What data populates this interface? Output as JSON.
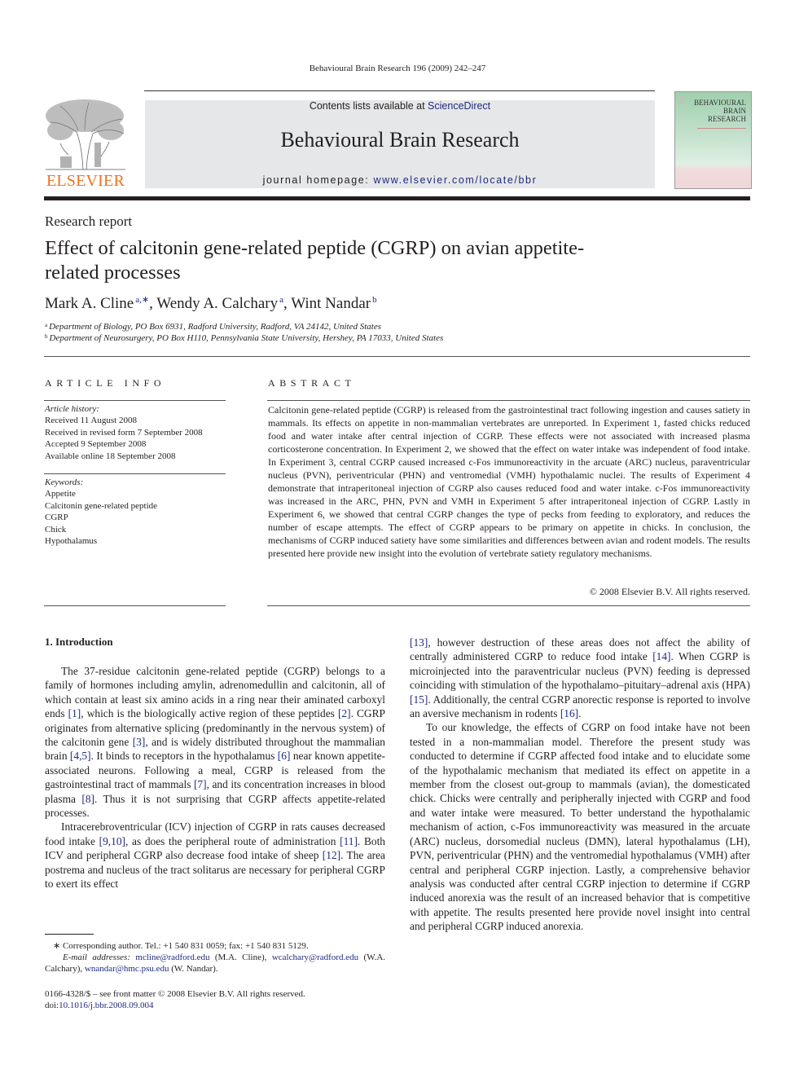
{
  "running_head": "Behavioural Brain Research 196 (2009) 242–247",
  "masthead": {
    "contents_prefix": "Contents lists available at ",
    "contents_link": "ScienceDirect",
    "journal_title": "Behavioural Brain Research",
    "homepage_prefix": "journal homepage: ",
    "homepage_link": "www.elsevier.com/locate/bbr",
    "publisher_logo_text": "ELSEVIER",
    "cover_title_lines": [
      "BEHAVIOURAL",
      "BRAIN",
      "RESEARCH"
    ],
    "colors": {
      "publisher_orange": "#f36f21",
      "link_blue": "#1f2a80",
      "masthead_gray": "#e6e7e8"
    }
  },
  "article": {
    "type": "Research report",
    "title": "Effect of calcitonin gene-related peptide (CGRP) on avian appetite-related processes",
    "authors": [
      {
        "name": "Mark A. Cline",
        "marks": "a,∗"
      },
      {
        "name": "Wendy A. Calchary",
        "marks": "a"
      },
      {
        "name": "Wint Nandar",
        "marks": "b"
      }
    ],
    "affiliations": [
      {
        "mark": "a",
        "text": "Department of Biology, PO Box 6931, Radford University, Radford, VA 24142, United States"
      },
      {
        "mark": "b",
        "text": "Department of Neurosurgery, PO Box H110, Pennsylvania State University, Hershey, PA 17033, United States"
      }
    ]
  },
  "article_info": {
    "heading": "ARTICLE INFO",
    "history_label": "Article history:",
    "history": [
      "Received 11 August 2008",
      "Received in revised form 7 September 2008",
      "Accepted 9 September 2008",
      "Available online 18 September 2008"
    ],
    "keywords_label": "Keywords:",
    "keywords": [
      "Appetite",
      "Calcitonin gene-related peptide",
      "CGRP",
      "Chick",
      "Hypothalamus"
    ]
  },
  "abstract": {
    "heading": "ABSTRACT",
    "text": "Calcitonin gene-related peptide (CGRP) is released from the gastrointestinal tract following ingestion and causes satiety in mammals. Its effects on appetite in non-mammalian vertebrates are unreported. In Experiment 1, fasted chicks reduced food and water intake after central injection of CGRP. These effects were not associated with increased plasma corticosterone concentration. In Experiment 2, we showed that the effect on water intake was independent of food intake. In Experiment 3, central CGRP caused increased c-Fos immunoreactivity in the arcuate (ARC) nucleus, paraventricular nucleus (PVN), periventricular (PHN) and ventromedial (VMH) hypothalamic nuclei. The results of Experiment 4 demonstrate that intraperitoneal injection of CGRP also causes reduced food and water intake. c-Fos immunoreactivity was increased in the ARC, PHN, PVN and VMH in Experiment 5 after intraperitoneal injection of CGRP. Lastly in Experiment 6, we showed that central CGRP changes the type of pecks from feeding to exploratory, and reduces the number of escape attempts. The effect of CGRP appears to be primary on appetite in chicks. In conclusion, the mechanisms of CGRP induced satiety have some similarities and differences between avian and rodent models. The results presented here provide new insight into the evolution of vertebrate satiety regulatory mechanisms.",
    "copyright": "© 2008 Elsevier B.V. All rights reserved."
  },
  "introduction": {
    "heading": "1.  Introduction",
    "paragraphs": [
      [
        {
          "t": "The 37-residue calcitonin gene-related peptide (CGRP) belongs to a family of hormones including amylin, adrenomedullin and calcitonin, all of which contain at least six amino acids in a ring near their aminated carboxyl ends "
        },
        {
          "ref": "[1]"
        },
        {
          "t": ", which is the biologically active region of these peptides "
        },
        {
          "ref": "[2]"
        },
        {
          "t": ". CGRP originates from alternative splicing (predominantly in the nervous system) of the calcitonin gene "
        },
        {
          "ref": "[3]"
        },
        {
          "t": ", and is widely distributed throughout the mammalian brain "
        },
        {
          "ref": "[4,5]"
        },
        {
          "t": ". It binds to receptors in the hypothalamus "
        },
        {
          "ref": "[6]"
        },
        {
          "t": " near known appetite-associated neurons. Following a meal, CGRP is released from the gastrointestinal tract of mammals "
        },
        {
          "ref": "[7]"
        },
        {
          "t": ", and its concentration increases in blood plasma "
        },
        {
          "ref": "[8]"
        },
        {
          "t": ". Thus it is not surprising that CGRP affects appetite-related processes."
        }
      ],
      [
        {
          "t": "Intracerebroventricular (ICV) injection of CGRP in rats causes decreased food intake "
        },
        {
          "ref": "[9,10]"
        },
        {
          "t": ", as does the peripheral route of administration "
        },
        {
          "ref": "[11]"
        },
        {
          "t": ". Both ICV and peripheral CGRP also decrease food intake of sheep "
        },
        {
          "ref": "[12]"
        },
        {
          "t": ". The area postrema and nucleus of the tract solitarus are necessary for peripheral CGRP to exert its effect"
        }
      ],
      [
        {
          "ref": "[13]"
        },
        {
          "t": ", however destruction of these areas does not affect the ability of centrally administered CGRP to reduce food intake "
        },
        {
          "ref": "[14]"
        },
        {
          "t": ". When CGRP is microinjected into the paraventricular nucleus (PVN) feeding is depressed coinciding with stimulation of the hypothalamo–pituitary–adrenal axis (HPA) "
        },
        {
          "ref": "[15]"
        },
        {
          "t": ". Additionally, the central CGRP anorectic response is reported to involve an aversive mechanism in rodents "
        },
        {
          "ref": "[16]"
        },
        {
          "t": "."
        }
      ],
      [
        {
          "t": "To our knowledge, the effects of CGRP on food intake have not been tested in a non-mammalian model. Therefore the present study was conducted to determine if CGRP affected food intake and to elucidate some of the hypothalamic mechanism that mediated its effect on appetite in a member from the closest out-group to mammals (avian), the domesticated chick. Chicks were centrally and peripherally injected with CGRP and food and water intake were measured. To better understand the hypothalamic mechanism of action, c-Fos immunoreactivity was measured in the arcuate (ARC) nucleus, dorsomedial nucleus (DMN), lateral hypothalamus (LH), PVN, periventricular (PHN) and the ventromedial hypothalamus (VMH) after central and peripheral CGRP injection. Lastly, a comprehensive behavior analysis was conducted after central CGRP injection to determine if CGRP induced anorexia was the result of an increased behavior that is competitive with appetite. The results presented here provide novel insight into central and peripheral CGRP induced anorexia."
        }
      ]
    ]
  },
  "footnotes": {
    "corresponding": "∗   Corresponding author. Tel.: +1 540 831 0059; fax: +1 540 831 5129.",
    "email_label": "E-mail addresses:",
    "emails": [
      {
        "address": "mcline@radford.edu",
        "owner": "(M.A. Cline),"
      },
      {
        "address": "wcalchary@radford.edu",
        "owner": "(W.A. Calchary),"
      },
      {
        "address": "wnandar@hmc.psu.edu",
        "owner": "(W. Nandar)."
      }
    ],
    "front_matter": "0166-4328/$ – see front matter © 2008 Elsevier B.V. All rights reserved.",
    "doi_prefix": "doi:",
    "doi": "10.1016/j.bbr.2008.09.004"
  }
}
